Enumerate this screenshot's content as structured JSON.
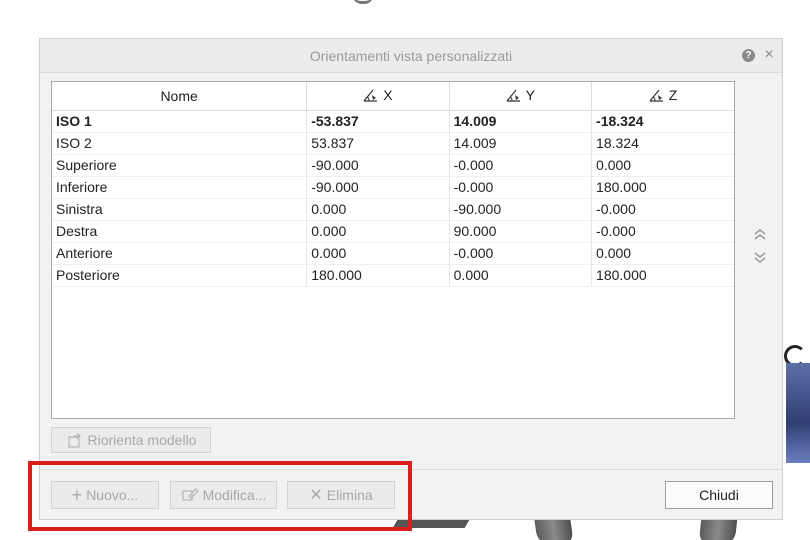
{
  "dialog": {
    "title": "Orientamenti vista personalizzati",
    "help_label": "?",
    "close_label": "×"
  },
  "table": {
    "headers": {
      "name": "Nome",
      "x": "X",
      "y": "Y",
      "z": "Z"
    },
    "rows": [
      {
        "name": "ISO 1",
        "x": "-53.837",
        "y": "14.009",
        "z": "-18.324",
        "selected": true
      },
      {
        "name": "ISO 2",
        "x": "53.837",
        "y": "14.009",
        "z": "18.324"
      },
      {
        "name": "Superiore",
        "x": "-90.000",
        "y": "-0.000",
        "z": "0.000"
      },
      {
        "name": "Inferiore",
        "x": "-90.000",
        "y": "-0.000",
        "z": "180.000"
      },
      {
        "name": "Sinistra",
        "x": "0.000",
        "y": "-90.000",
        "z": "-0.000"
      },
      {
        "name": "Destra",
        "x": "0.000",
        "y": "90.000",
        "z": "-0.000"
      },
      {
        "name": "Anteriore",
        "x": "0.000",
        "y": "-0.000",
        "z": "0.000"
      },
      {
        "name": "Posteriore",
        "x": "180.000",
        "y": "0.000",
        "z": "180.000"
      }
    ]
  },
  "buttons": {
    "reorient": "Riorienta modello",
    "new": "Nuovo...",
    "modify": "Modifica...",
    "delete": "Elimina",
    "close": "Chiudi"
  },
  "icons": {
    "angle": "angle-icon",
    "move_up": "double-chevron-up-icon",
    "move_down": "double-chevron-down-icon",
    "reorient": "reorient-model-icon",
    "plus": "plus-icon",
    "edit": "edit-icon",
    "delete": "x-icon"
  },
  "colors": {
    "highlight": "#d9201c",
    "disabled_text": "#a8a8a8"
  }
}
